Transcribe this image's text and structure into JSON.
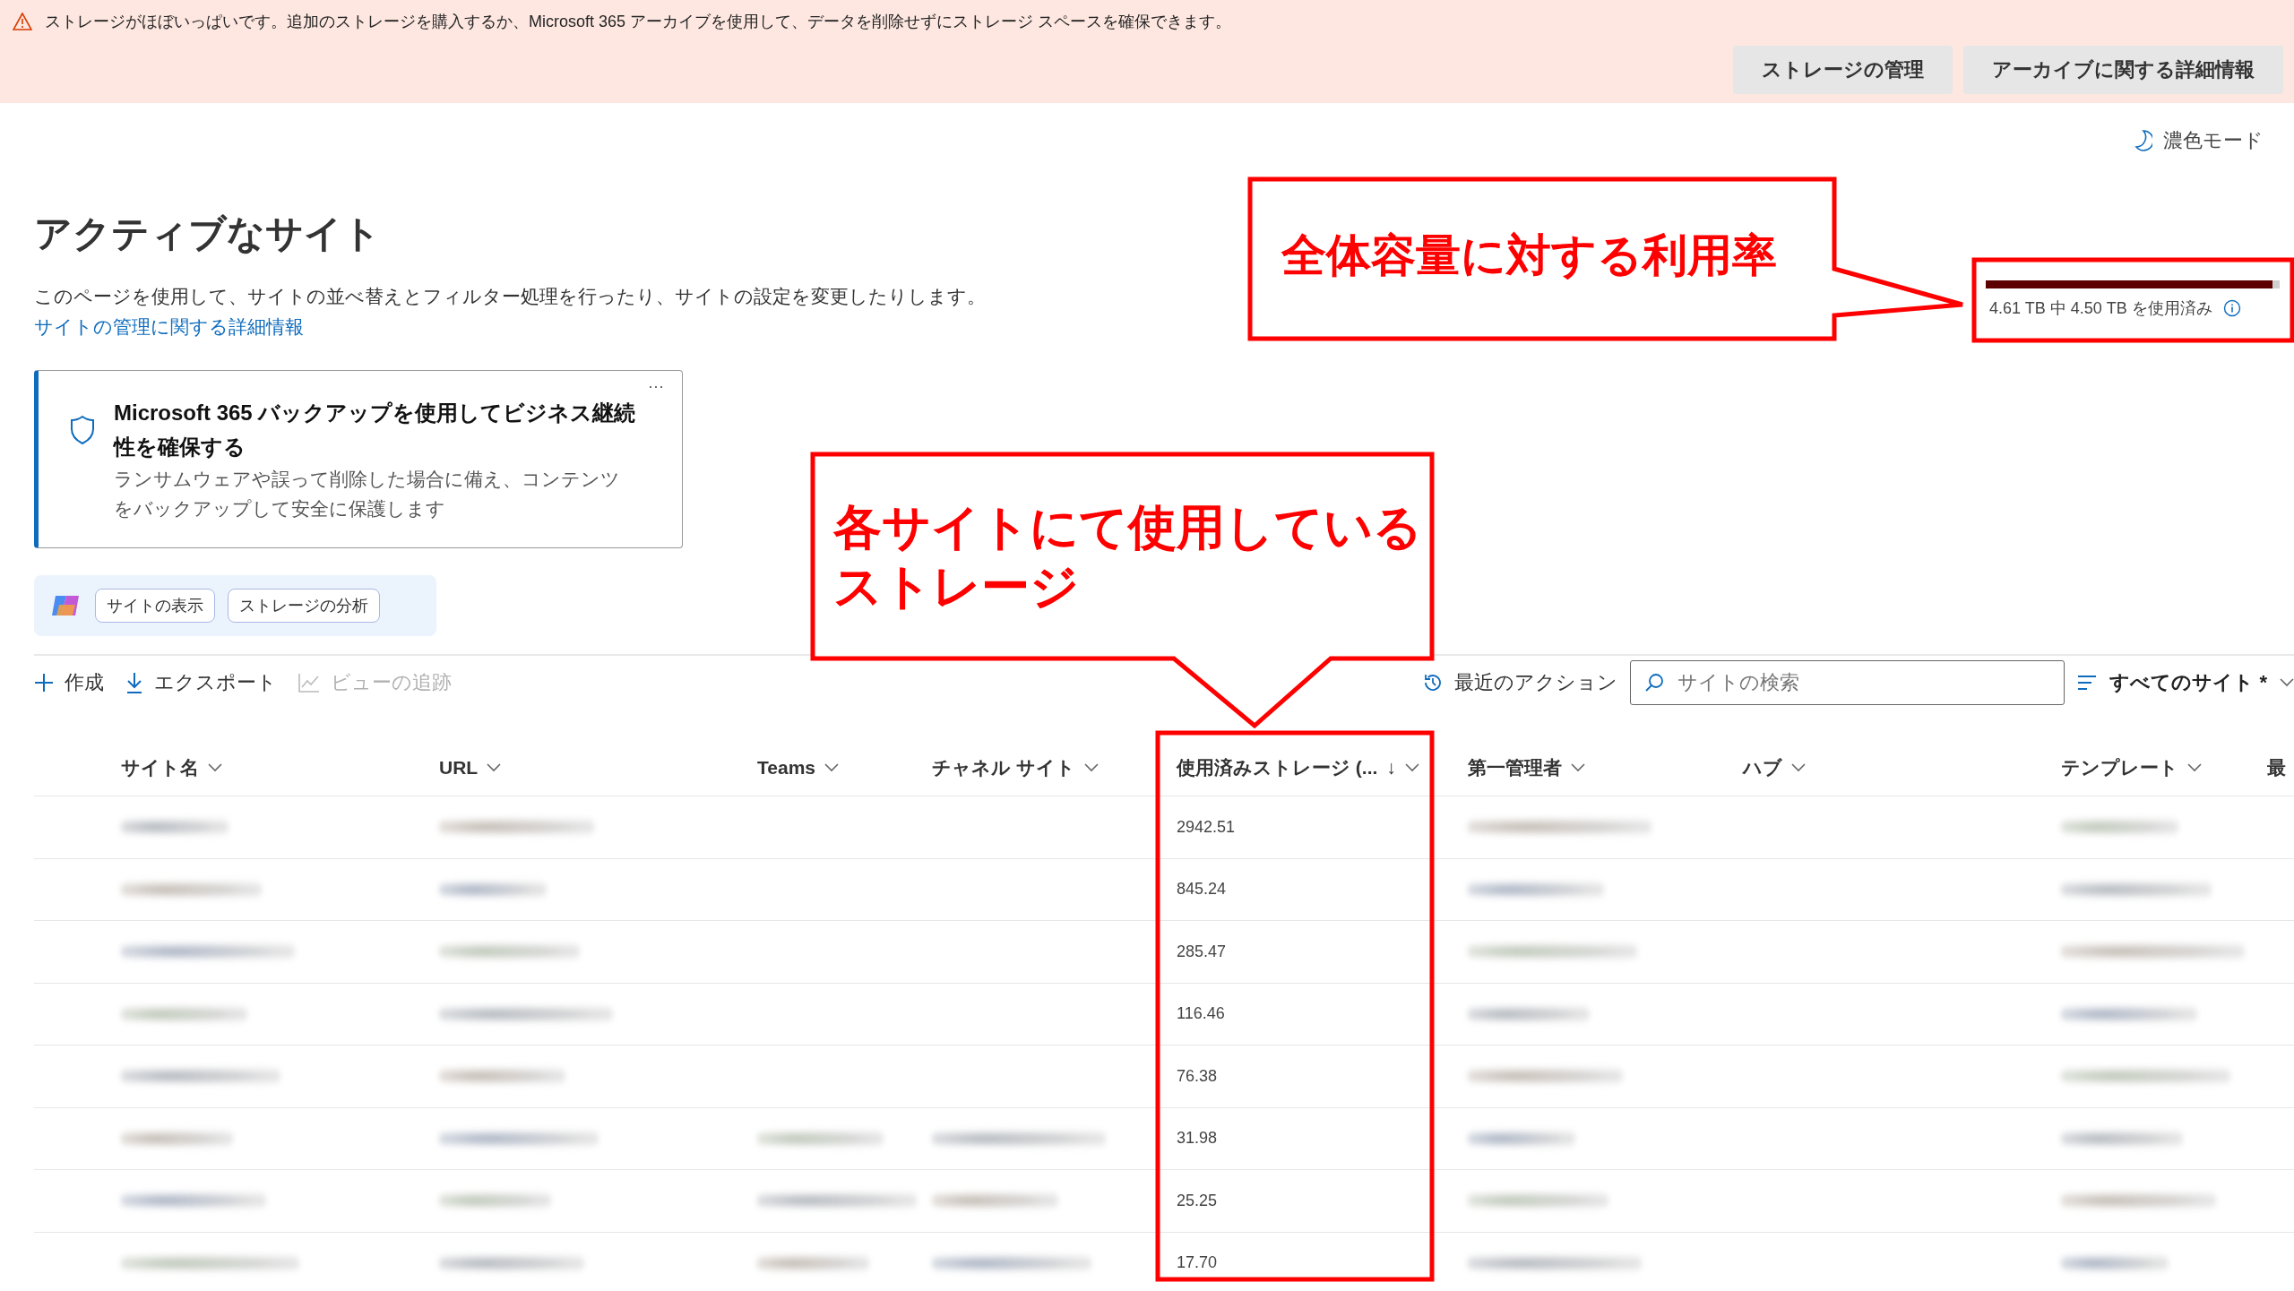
{
  "banner": {
    "message": "ストレージがほぼいっぱいです。追加のストレージを購入するか、Microsoft 365 アーカイブを使用して、データを削除せずにストレージ スペースを確保できます。",
    "buttons": [
      "ストレージの管理",
      "アーカイブに関する詳細情報"
    ]
  },
  "theme_toggle": {
    "label": "濃色モード"
  },
  "page": {
    "title": "アクティブなサイト",
    "description": "このページを使用して、サイトの並べ替えとフィルター処理を行ったり、サイトの設定を変更したりします。",
    "link": "サイトの管理に関する詳細情報"
  },
  "storage_meter": {
    "level": 0.976,
    "reading": "4.61 TB 中 4.50 TB を使用済み"
  },
  "promo_card": {
    "title": "Microsoft 365 バックアップを使用してビジネス継続性を確保する",
    "body": "ランサムウェアや誤って削除した場合に備え、コンテンツをバックアップして安全に保護します",
    "more": "···"
  },
  "copilot_chips": [
    "サイトの表示",
    "ストレージの分析"
  ],
  "toolbar": [
    {
      "label": "作成",
      "kind": "create",
      "disabled": false
    },
    {
      "label": "エクスポート",
      "kind": "export",
      "disabled": false
    },
    {
      "label": "ビューの追跡",
      "kind": "track",
      "disabled": true
    }
  ],
  "recent_actions": "最近のアクション",
  "search": {
    "placeholder": "サイトの検索"
  },
  "view_filter": "すべてのサイト *",
  "table": {
    "columns": [
      {
        "label": "サイト名",
        "menu": true
      },
      {
        "label": "URL",
        "menu": true
      },
      {
        "label": "Teams",
        "menu": true
      },
      {
        "label": "チャネル サイト",
        "menu": true
      },
      {
        "label": "使用済みストレージ (...",
        "menu": true,
        "sort": "↓"
      },
      {
        "label": "第一管理者",
        "menu": true
      },
      {
        "label": "ハブ",
        "menu": true
      },
      {
        "label": "テンプレート",
        "menu": true
      },
      {
        "label": "最"
      }
    ],
    "rows": [
      {
        "storage": "2942.51"
      },
      {
        "storage": "845.24"
      },
      {
        "storage": "285.47"
      },
      {
        "storage": "116.46"
      },
      {
        "storage": "76.38"
      },
      {
        "storage": "31.98"
      },
      {
        "storage": "25.25"
      },
      {
        "storage": "17.70"
      }
    ]
  },
  "annotations": [
    {
      "kind": "callout",
      "lines": [
        "全体容量に対する利用率"
      ]
    },
    {
      "kind": "callout",
      "lines": [
        "各サイトにて使用している",
        "ストレージ"
      ]
    }
  ]
}
